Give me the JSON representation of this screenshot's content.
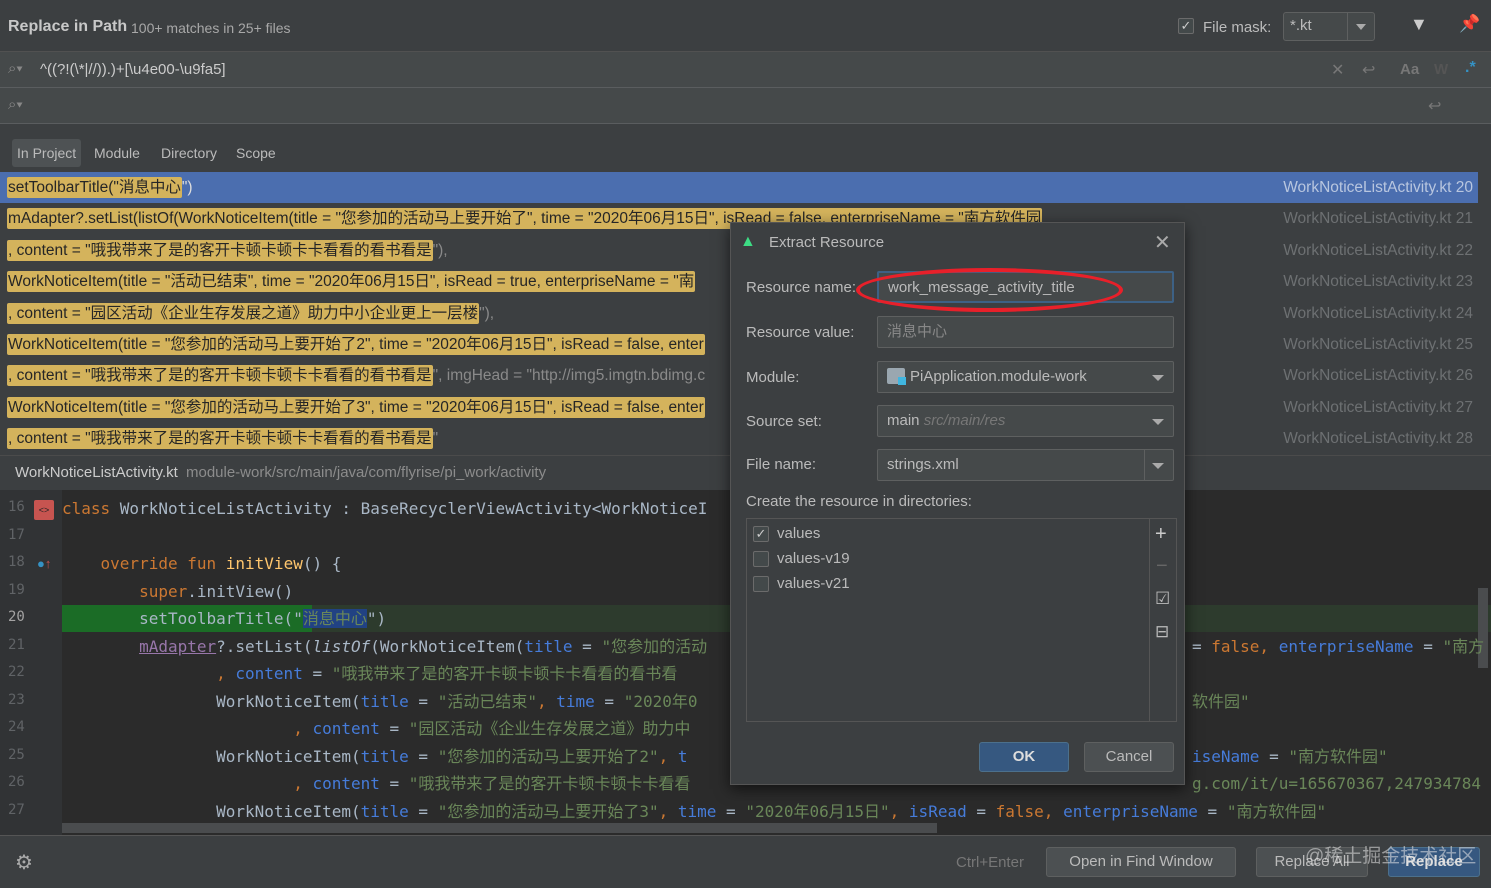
{
  "header": {
    "title": "Replace in Path",
    "match_summary": "100+ matches in 25+ files",
    "file_mask_label": "File mask:",
    "file_mask_checked": true,
    "file_mask_value": "*.kt",
    "filter_icon": "filter-icon",
    "pin_icon": "pin-icon"
  },
  "search": {
    "query": "^((?!(\\*|//)).)+[\\u4e00-\\u9fa5]",
    "replace": "",
    "match_case_label": "Aa",
    "words_label": "W",
    "regex_label": ".*"
  },
  "scope_tabs": [
    {
      "label": "In Project",
      "selected": true
    },
    {
      "label": "Module"
    },
    {
      "label": "Directory"
    },
    {
      "label": "Scope"
    }
  ],
  "results": [
    {
      "match": "setToolbarTitle(\"消息中心",
      "rest": "\")",
      "file": "WorkNoticeListActivity.kt 20",
      "selected": true
    },
    {
      "match": "mAdapter?.setList(listOf(WorkNoticeItem(title = \"您参加的活动马上要开始了\", time = \"2020年06月15日\", isRead = false, enterpriseName = \"南方软件园",
      "rest": "",
      "file": "WorkNoticeListActivity.kt 21"
    },
    {
      "match": ", content = \"哦我带来了是的客开卡顿卡顿卡卡看看的看书看是",
      "rest": "\"),",
      "file": "WorkNoticeListActivity.kt 22"
    },
    {
      "match": "WorkNoticeItem(title = \"活动已结束\", time = \"2020年06月15日\", isRead = true, enterpriseName = \"南",
      "rest": "",
      "file": "WorkNoticeListActivity.kt 23"
    },
    {
      "match": ", content = \"园区活动《企业生存发展之道》助力中小企业更上一层楼",
      "rest": "\"),",
      "file": "WorkNoticeListActivity.kt 24"
    },
    {
      "match": "WorkNoticeItem(title = \"您参加的活动马上要开始了2\", time = \"2020年06月15日\", isRead = false, enter",
      "rest": "",
      "file": "WorkNoticeListActivity.kt 25"
    },
    {
      "match": ", content = \"哦我带来了是的客开卡顿卡顿卡卡看看的看书看是",
      "rest": "\", imgHead = \"http://img5.imgtn.bdimg.c",
      "file": "WorkNoticeListActivity.kt 26"
    },
    {
      "match": "WorkNoticeItem(title = \"您参加的活动马上要开始了3\", time = \"2020年06月15日\", isRead = false, enter",
      "rest": "",
      "file": "WorkNoticeListActivity.kt 27"
    },
    {
      "match": ", content = \"哦我带来了是的客开卡顿卡顿卡卡看看的看书看是",
      "rest": "\"",
      "file": "WorkNoticeListActivity.kt 28"
    }
  ],
  "preview": {
    "file": "WorkNoticeListActivity.kt",
    "path": "module-work/src/main/java/com/flyrise/pi_work/activity"
  },
  "editor": {
    "line_numbers": [
      "16",
      "17",
      "18",
      "19",
      "20",
      "21",
      "22",
      "23",
      "24",
      "25",
      "26",
      "27"
    ],
    "lines": [
      [
        {
          "t": "class ",
          "c": "kw"
        },
        {
          "t": "WorkNoticeListActivity : BaseRecyclerViewActivity<WorkNoticeI"
        }
      ],
      [],
      [
        {
          "t": "    override fun ",
          "c": "kw"
        },
        {
          "t": "initView",
          "c": "fn"
        },
        {
          "t": "() {"
        }
      ],
      [
        {
          "t": "        super",
          "c": "kw"
        },
        {
          "t": ".initView()"
        }
      ],
      [
        {
          "t": "        setToolbarTitle(\""
        },
        {
          "t": "消息中心",
          "c": "sel"
        },
        {
          "t": "\")"
        }
      ],
      [
        {
          "t": "        "
        },
        {
          "t": "mAdapter",
          "c": "und"
        },
        {
          "t": "?.setList("
        },
        {
          "t": "listOf",
          "c": "it"
        },
        {
          "t": "(WorkNoticeItem("
        },
        {
          "t": "title",
          "c": "nm"
        },
        {
          "t": " = "
        },
        {
          "t": "\"您参加的活动",
          "c": "str"
        }
      ],
      [
        {
          "t": "                "
        },
        {
          "t": ", ",
          "c": "kw"
        },
        {
          "t": "content",
          "c": "nm"
        },
        {
          "t": " = "
        },
        {
          "t": "\"哦我带来了是的客开卡顿卡顿卡卡看看的看书看",
          "c": "str"
        }
      ],
      [
        {
          "t": "                WorkNoticeItem("
        },
        {
          "t": "title",
          "c": "nm"
        },
        {
          "t": " = "
        },
        {
          "t": "\"活动已结束\"",
          "c": "str"
        },
        {
          "t": ", ",
          "c": "kw"
        },
        {
          "t": "time",
          "c": "nm"
        },
        {
          "t": " = "
        },
        {
          "t": "\"2020年0",
          "c": "str"
        }
      ],
      [
        {
          "t": "                        "
        },
        {
          "t": ", ",
          "c": "kw"
        },
        {
          "t": "content",
          "c": "nm"
        },
        {
          "t": " = "
        },
        {
          "t": "\"园区活动《企业生存发展之道》助力中",
          "c": "str"
        }
      ],
      [
        {
          "t": "                WorkNoticeItem("
        },
        {
          "t": "title",
          "c": "nm"
        },
        {
          "t": " = "
        },
        {
          "t": "\"您参加的活动马上要开始了2\"",
          "c": "str"
        },
        {
          "t": ", ",
          "c": "kw"
        },
        {
          "t": "t",
          "c": "nm"
        }
      ],
      [
        {
          "t": "                        "
        },
        {
          "t": ", ",
          "c": "kw"
        },
        {
          "t": "content",
          "c": "nm"
        },
        {
          "t": " = "
        },
        {
          "t": "\"哦我带来了是的客开卡顿卡顿卡卡看看",
          "c": "str"
        }
      ],
      [
        {
          "t": "                WorkNoticeItem("
        },
        {
          "t": "title",
          "c": "nm"
        },
        {
          "t": " = "
        },
        {
          "t": "\"您参加的活动马上要开始了3\"",
          "c": "str"
        },
        {
          "t": ", ",
          "c": "kw"
        },
        {
          "t": "time",
          "c": "nm"
        },
        {
          "t": " = "
        },
        {
          "t": "\"2020年06月15日\"",
          "c": "str"
        },
        {
          "t": ", ",
          "c": "kw"
        },
        {
          "t": "isRead",
          "c": "nm"
        },
        {
          "t": " = "
        },
        {
          "t": "false",
          "c": "kw"
        },
        {
          "t": ", ",
          "c": "kw"
        },
        {
          "t": "enterpriseName",
          "c": "nm"
        },
        {
          "t": " = "
        },
        {
          "t": "\"南方软件园\"",
          "c": "str"
        }
      ]
    ],
    "right_fragments": [
      {
        "line": 5,
        "tokens": [
          {
            "t": "= "
          },
          {
            "t": "false, ",
            "c": "kw"
          },
          {
            "t": "enterpriseName",
            "c": "nm"
          },
          {
            "t": " = "
          },
          {
            "t": "\"南方",
            "c": "str"
          }
        ]
      },
      {
        "line": 7,
        "tokens": [
          {
            "t": "软件园\"",
            "c": "str"
          }
        ]
      },
      {
        "line": 9,
        "tokens": [
          {
            "t": "iseName",
            "c": "nm"
          },
          {
            "t": " = "
          },
          {
            "t": "\"南方软件园\"",
            "c": "str"
          }
        ]
      },
      {
        "line": 10,
        "tokens": [
          {
            "t": "g.com/it/u=165670367,247934784",
            "c": "str"
          }
        ]
      }
    ]
  },
  "dialog": {
    "title": "Extract Resource",
    "resource_name_label": "Resource name:",
    "resource_name": "work_message_activity_title",
    "resource_value_label": "Resource value:",
    "resource_value": "消息中心",
    "module_label": "Module:",
    "module": "PiApplication.module-work",
    "source_set_label": "Source set:",
    "source_set": "main",
    "source_set_path": "src/main/res",
    "file_name_label": "File name:",
    "file_name": "strings.xml",
    "directories_label": "Create the resource in directories:",
    "directories": [
      {
        "label": "values",
        "checked": true
      },
      {
        "label": "values-v19",
        "checked": false
      },
      {
        "label": "values-v21",
        "checked": false
      }
    ],
    "ok": "OK",
    "cancel": "Cancel",
    "annotation_color": "#e8202a"
  },
  "footer": {
    "shortcut": "Ctrl+Enter",
    "open_find": "Open in Find Window",
    "replace_all": "Replace All",
    "replace": "Replace",
    "watermark": "@稀土掘金技术社区"
  },
  "colors": {
    "accent": "#4b6eaf",
    "highlight": "#d4b35c",
    "primary_button": "#365880"
  }
}
